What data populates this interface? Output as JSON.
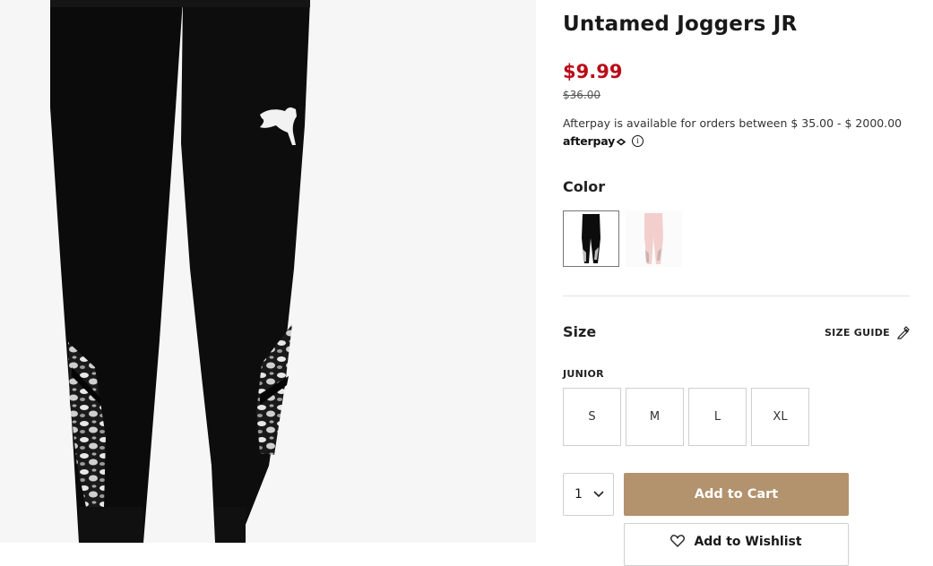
{
  "product": {
    "title": "Untamed Joggers JR",
    "price": "$9.99",
    "original_price": "$36.00",
    "afterpay_text": "Afterpay is available for orders between $ 35.00 - $ 2000.00",
    "afterpay_logo": "afterpay",
    "afterpay_info_glyph": "i",
    "image_alt": "Untamed Joggers JR black"
  },
  "color": {
    "label": "Color",
    "swatches": [
      {
        "name": "Black",
        "hex": "#0c0c0c",
        "selected": true
      },
      {
        "name": "Pink",
        "hex": "#f2cfcd",
        "selected": false
      }
    ]
  },
  "size": {
    "label": "Size",
    "guide_label": "SIZE GUIDE",
    "group_label": "JUNIOR",
    "options": [
      "S",
      "M",
      "L",
      "XL"
    ]
  },
  "cart": {
    "quantity": "1",
    "add_label": "Add to Cart",
    "wishlist_label": "Add to Wishlist"
  },
  "colors": {
    "price_red": "#ba0c19",
    "cart_button": "#b3926e"
  },
  "icons": {
    "size_guide": "ruler-pencil-icon",
    "quantity": "chevron-down-icon",
    "wishlist": "heart-icon"
  }
}
